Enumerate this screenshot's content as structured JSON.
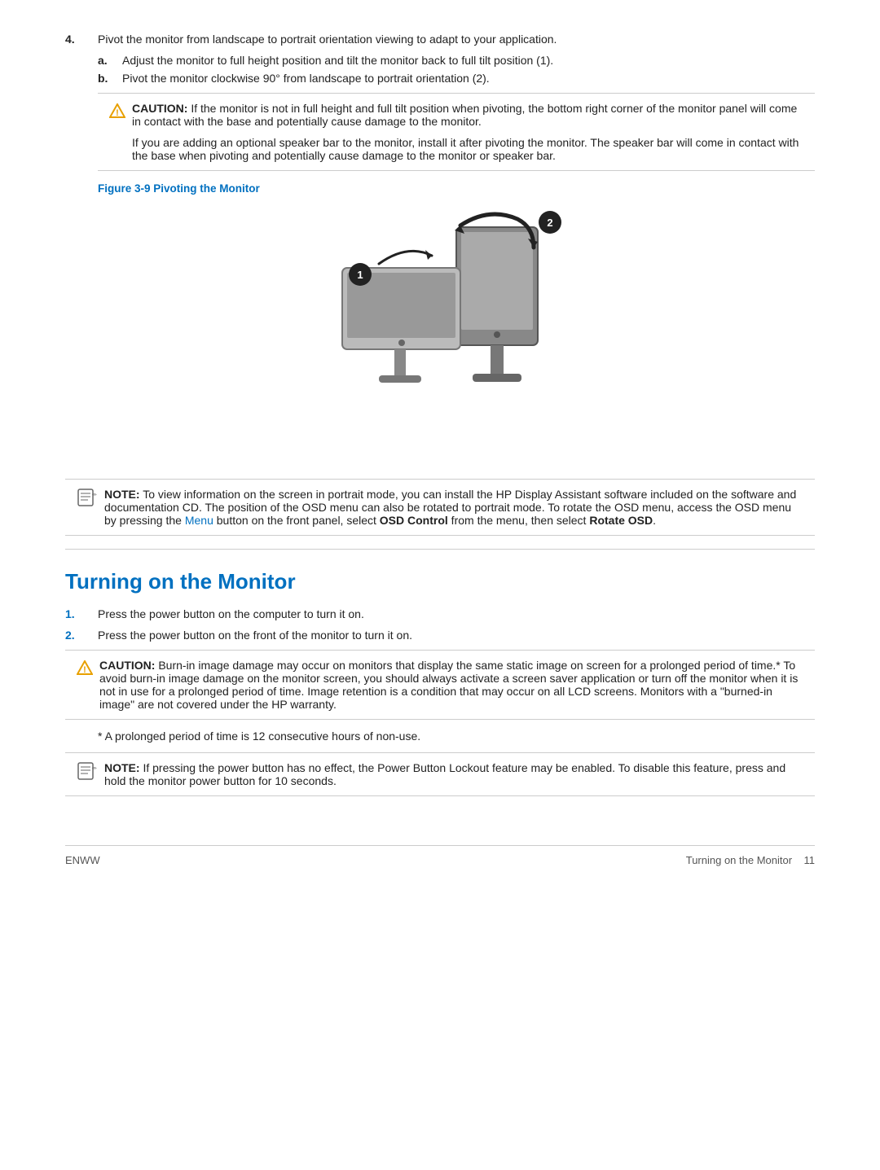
{
  "page": {
    "footer_left": "ENWW",
    "footer_right": "Turning on the Monitor",
    "footer_page": "11"
  },
  "steps": {
    "step4": {
      "num": "4.",
      "text": "Pivot the monitor from landscape to portrait orientation viewing to adapt to your application."
    },
    "step4a": {
      "label": "a.",
      "text": "Adjust the monitor to full height position and tilt the monitor back to full tilt position (1)."
    },
    "step4b": {
      "label": "b.",
      "text": "Pivot the monitor clockwise 90° from landscape to portrait orientation (2)."
    },
    "caution1_label": "CAUTION:",
    "caution1_text": "If the monitor is not in full height and full tilt position when pivoting, the bottom right corner of the monitor panel will come in contact with the base and potentially cause damage to the monitor.",
    "caution1_extra": "If you are adding an optional speaker bar to the monitor, install it after pivoting the monitor. The speaker bar will come in contact with the base when pivoting and potentially cause damage to the monitor or speaker bar.",
    "figure_caption": "Figure 3-9",
    "figure_title": "Pivoting the Monitor",
    "note1_label": "NOTE:",
    "note1_text": "To view information on the screen in portrait mode, you can install the HP Display Assistant software included on the software and documentation CD. The position of the OSD menu can also be rotated to portrait mode. To rotate the OSD menu, access the OSD menu by pressing the",
    "note1_link": "Menu",
    "note1_text2": "button on the front panel, select",
    "note1_bold1": "OSD Control",
    "note1_text3": "from the menu, then select",
    "note1_bold2": "Rotate OSD",
    "note1_end": "."
  },
  "section": {
    "title": "Turning on the Monitor",
    "step1_num": "1.",
    "step1_text": "Press the power button on the computer to turn it on.",
    "step2_num": "2.",
    "step2_text": "Press the power button on the front of the monitor to turn it on.",
    "caution2_label": "CAUTION:",
    "caution2_text": "Burn-in image damage may occur on monitors that display the same static image on screen for a prolonged period of time.* To avoid burn-in image damage on the monitor screen, you should always activate a screen saver application or turn off the monitor when it is not in use for a prolonged period of time. Image retention is a condition that may occur on all LCD screens. Monitors with a \"burned-in image\" are not covered under the HP warranty.",
    "footnote": "* A prolonged period of time is 12 consecutive hours of non-use.",
    "note2_label": "NOTE:",
    "note2_text": "If pressing the power button has no effect, the Power Button Lockout feature may be enabled. To disable this feature, press and hold the monitor power button for 10 seconds."
  }
}
